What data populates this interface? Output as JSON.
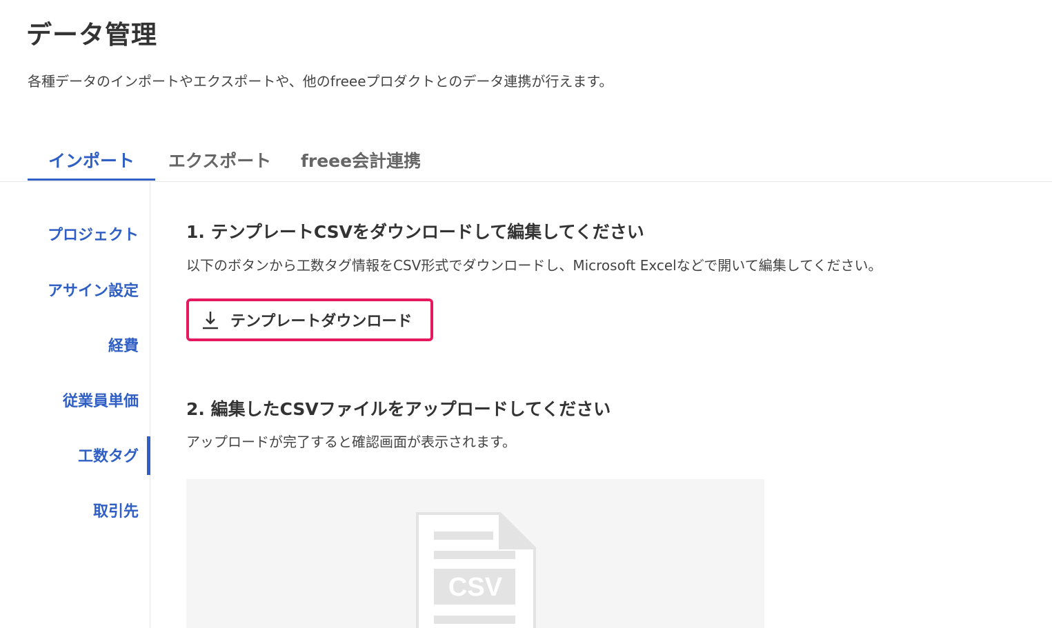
{
  "page": {
    "title": "データ管理",
    "description": "各種データのインポートやエクスポートや、他のfreeeプロダクトとのデータ連携が行えます。"
  },
  "tabs": [
    {
      "label": "インポート",
      "active": true
    },
    {
      "label": "エクスポート",
      "active": false
    },
    {
      "label": "freee会計連携",
      "active": false
    }
  ],
  "sidebar": {
    "items": [
      {
        "label": "プロジェクト"
      },
      {
        "label": "アサイン設定"
      },
      {
        "label": "経費"
      },
      {
        "label": "従業員単価"
      },
      {
        "label": "工数タグ",
        "active": true
      },
      {
        "label": "取引先"
      }
    ]
  },
  "step1": {
    "title": "1. テンプレートCSVをダウンロードして編集してください",
    "description": "以下のボタンから工数タグ情報をCSV形式でダウンロードし、Microsoft Excelなどで開いて編集してください。",
    "button_label": "テンプレートダウンロード",
    "button_icon": "download-icon"
  },
  "step2": {
    "title": "2. 編集したCSVファイルをアップロードしてください",
    "description": "アップロードが完了すると確認画面が表示されます。",
    "dropzone_icon": "csv-file-icon",
    "dropzone_icon_text": "CSV"
  },
  "colors": {
    "accent": "#2f5fc4",
    "highlight_border": "#e6195f",
    "dropzone_bg": "#f5f5f5",
    "icon_gray": "#e3e3e3"
  }
}
